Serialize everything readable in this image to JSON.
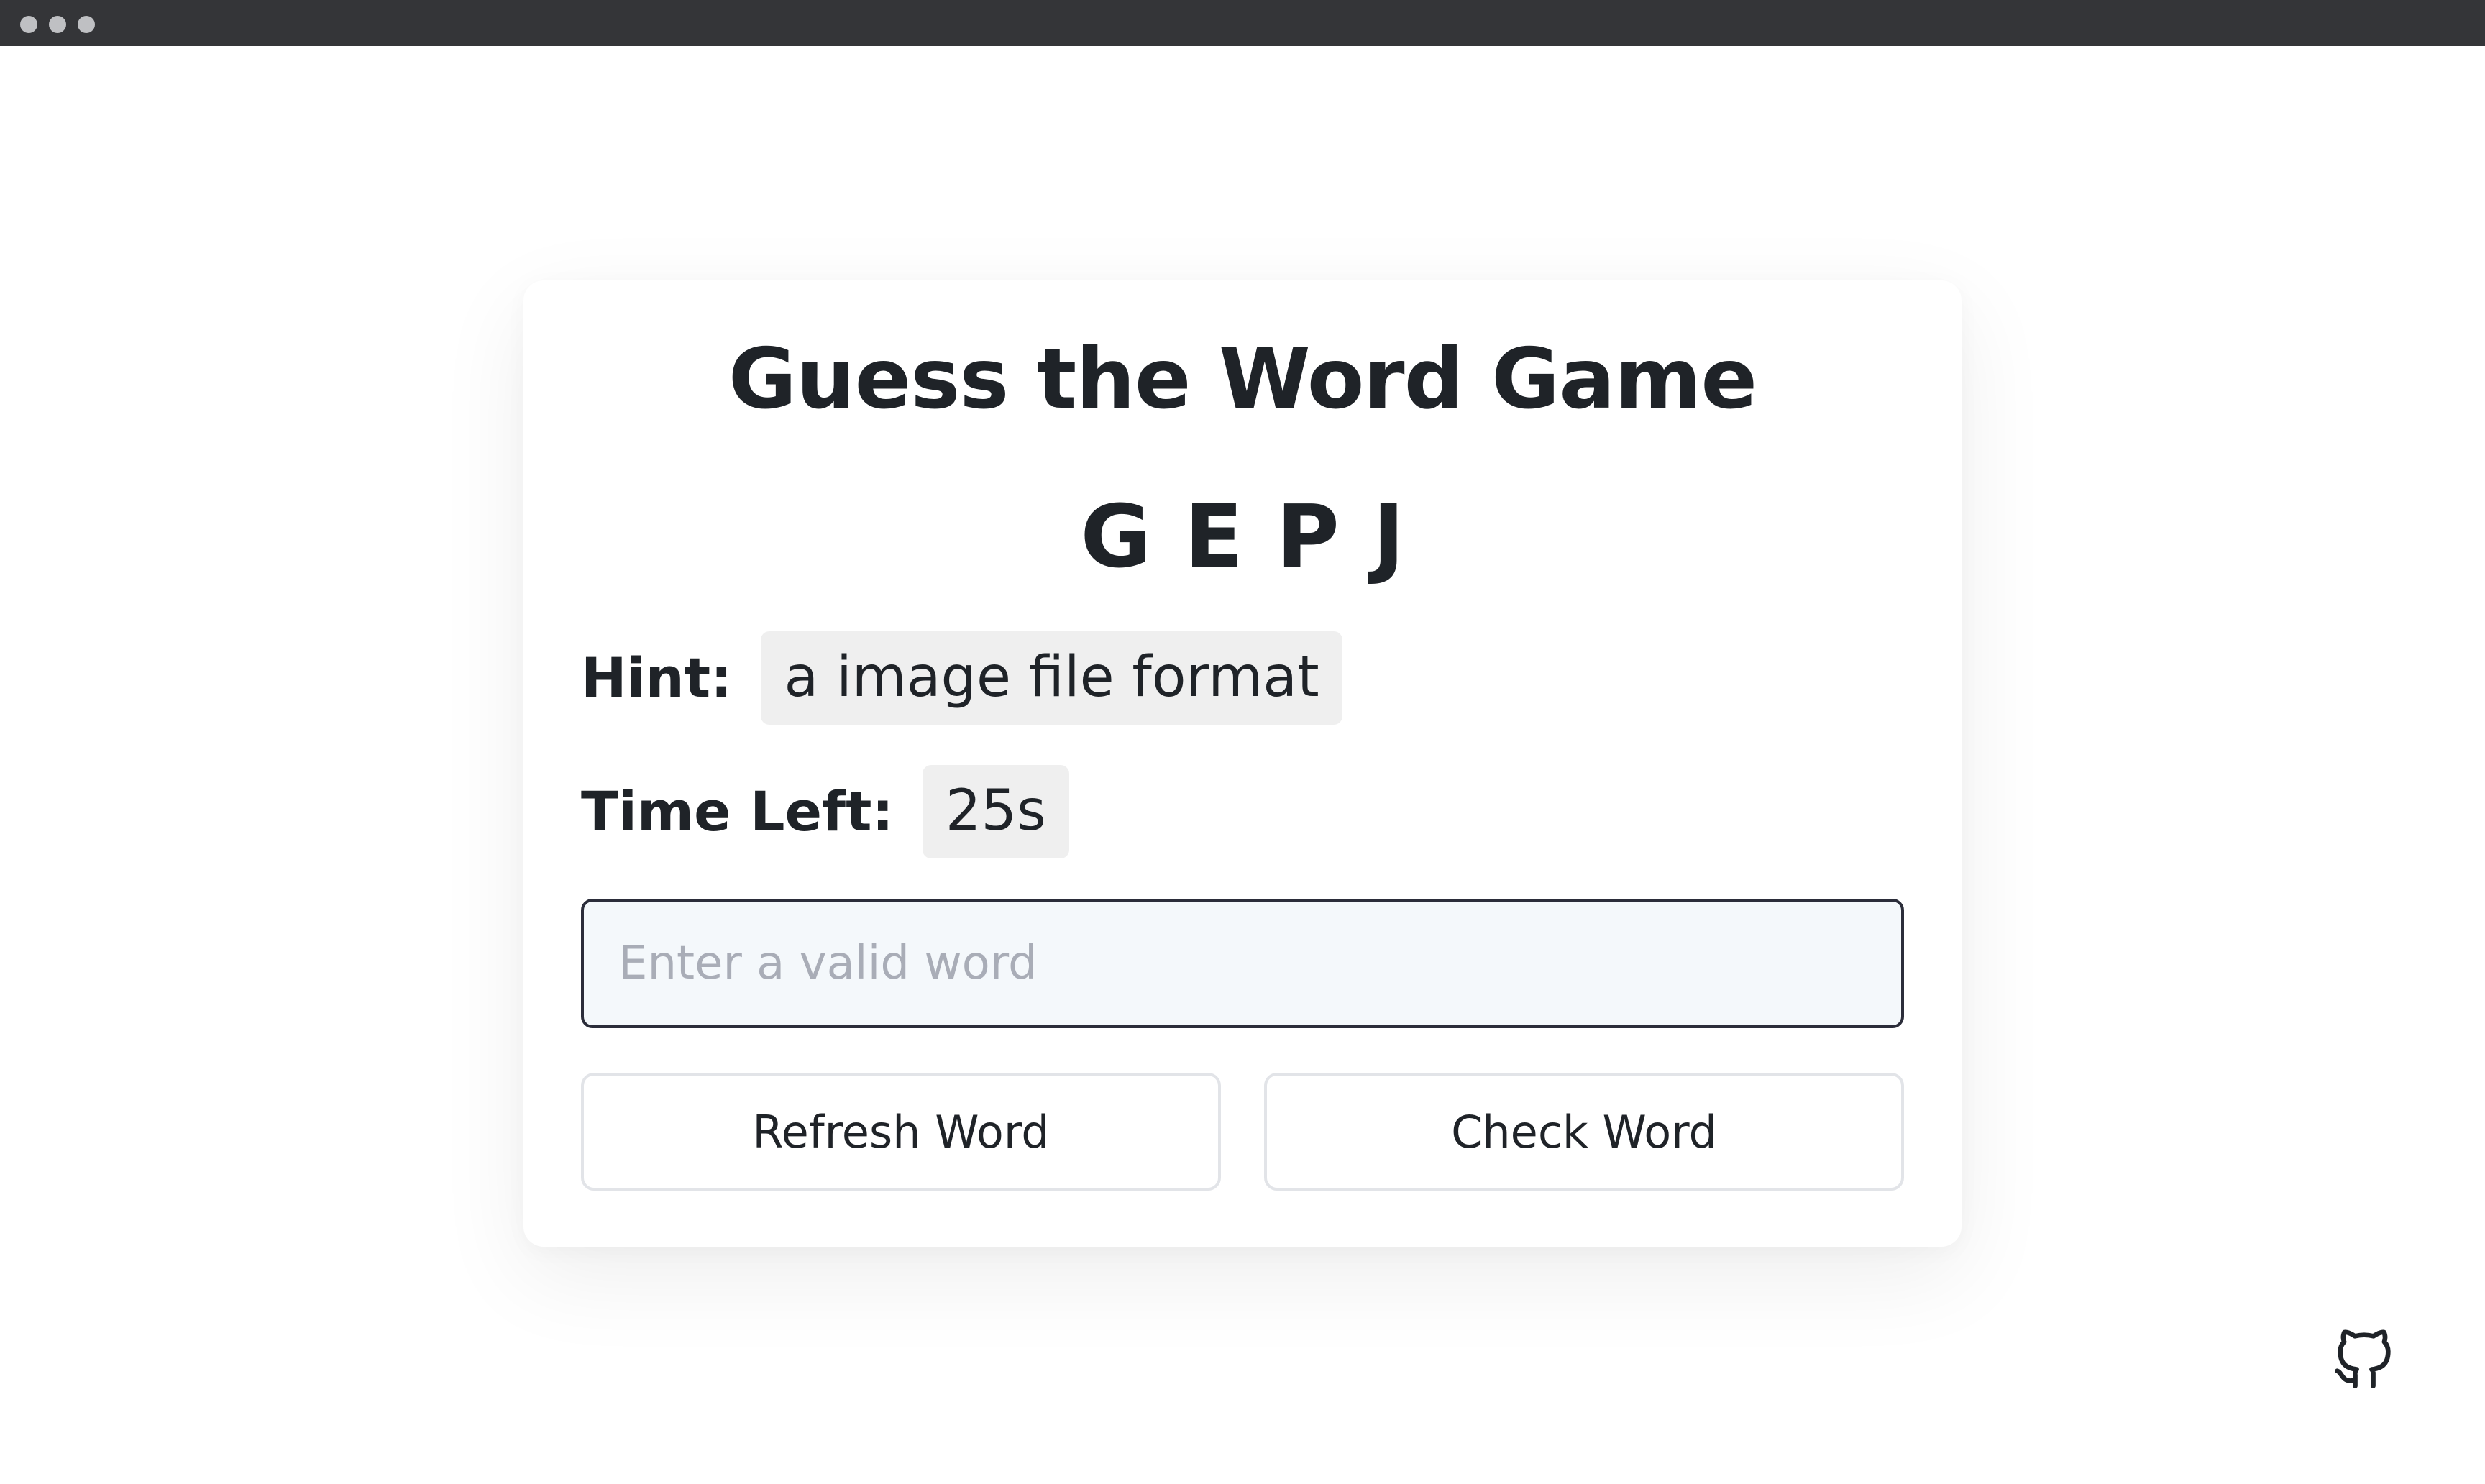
{
  "window": {
    "controls": [
      "close-dot",
      "minimize-dot",
      "maximize-dot"
    ]
  },
  "game": {
    "title": "Guess the Word Game",
    "scrambled_word": "GEPJ",
    "hint_label": "Hint:",
    "hint_value": "a image file format",
    "time_label": "Time Left:",
    "time_value": "25s",
    "input_placeholder": "Enter a valid word",
    "input_value": "",
    "refresh_label": "Refresh Word",
    "check_label": "Check Word"
  },
  "footer": {
    "link_icon": "github-icon"
  },
  "colors": {
    "window_bar": "#343538",
    "text": "#1f2328",
    "pill_bg": "#efefef",
    "input_bg": "#f4f8fb",
    "input_border": "#2b2d3a",
    "button_border": "#e2e4e8"
  }
}
